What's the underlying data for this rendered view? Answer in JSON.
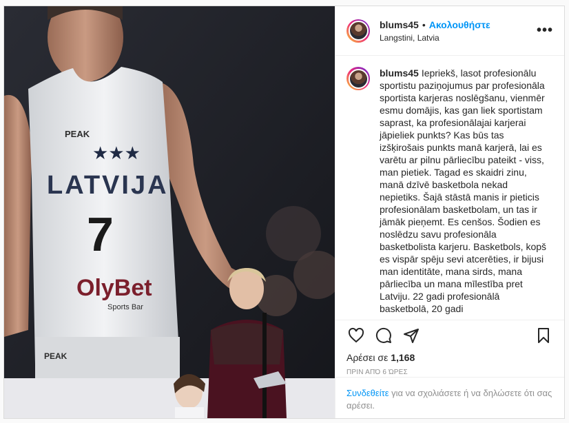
{
  "post": {
    "username": "blums45",
    "follow_label": "Ακολουθήστε",
    "location": "Langstini, Latvia",
    "more_icon": "more-horizontal-icon",
    "caption": "Iepriekš, lasot profesionālu sportistu paziņojumus par profesionāla sportista karjeras noslēgšanu, vienmēr esmu domājis, kas gan liek sportistam saprast, ka profesionālajai karjerai jāpieliek punkts? Kas būs tas izšķirošais punkts manā karjerā, lai es varētu ar pilnu pārliecību pateikt - viss, man pietiek. Tagad es skaidri zinu, manā dzīvē basketbola nekad nepietiks. Šajā stāstā manis ir pieticis profesionālam basketbolam, un tas ir jāmāk pieņemt. Es cenšos. Šodien es noslēdzu savu profesionāla basketbolista karjeru. Basketbols, kopš es vispār spēju sevi atcerēties, ir bijusi man identitāte, mana sirds, mana pārliecība un mana mīlestība pret Latviju. 22 gadi profesionālā basketbolā, 20 gadi",
    "likes_prefix": "Αρέσει σε",
    "likes_count": "1,168",
    "time_ago": "ΠΡΙΝ ΑΠΌ 6 ΏΡΕΣ",
    "login_link": "Συνδεθείτε",
    "login_text": " για να σχολιάσετε ή να δηλώσετε ότι σας αρέσει.",
    "image": {
      "jersey_brand": "PEAK",
      "jersey_team": "LATVIJA",
      "jersey_number": "7",
      "jersey_sponsor": "OlyBet",
      "jersey_sponsor_sub": "Sports Bar"
    }
  },
  "icons": [
    "heart-icon",
    "comment-icon",
    "share-icon",
    "bookmark-icon"
  ],
  "colors": {
    "accent": "#0095f6",
    "muted": "#8e8e8e",
    "border": "#dbdbdb"
  }
}
